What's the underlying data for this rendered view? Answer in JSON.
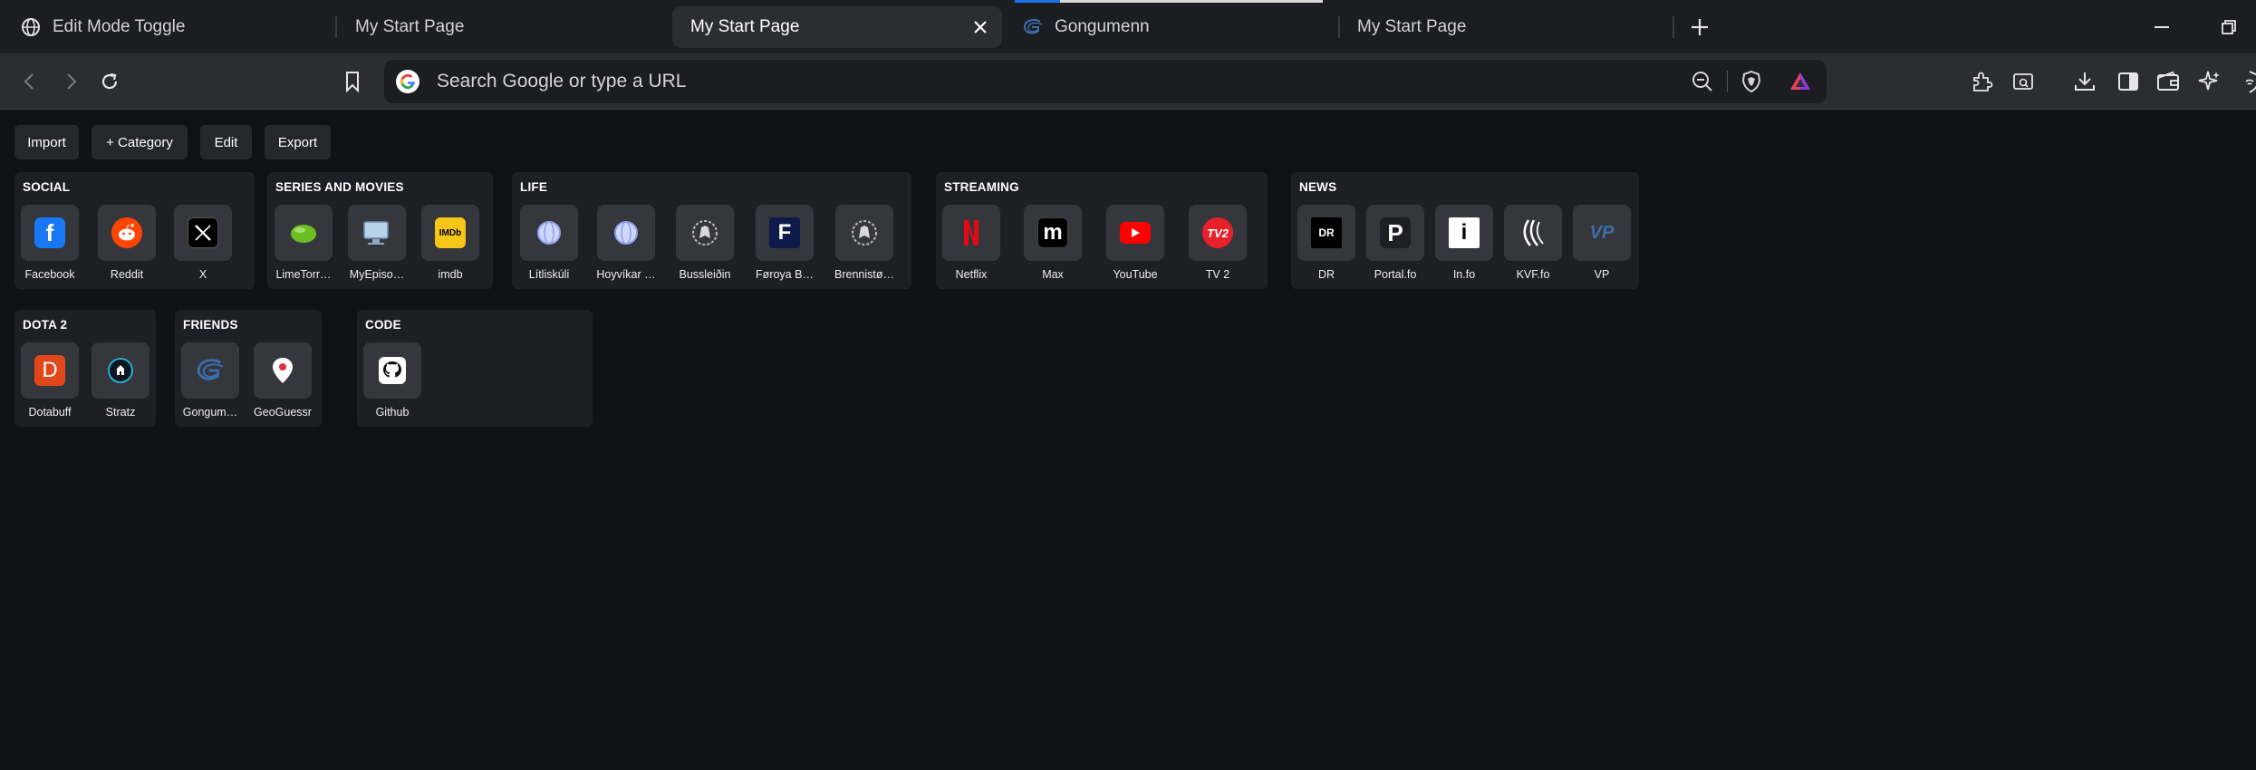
{
  "tabs": [
    {
      "title": "Edit Mode Toggle",
      "icon": "globe-icon"
    },
    {
      "title": "My Start Page",
      "icon": ""
    },
    {
      "title": "My Start Page",
      "icon": "",
      "active": true
    },
    {
      "title": "Gongumenn",
      "icon": "gongumenn-icon"
    },
    {
      "title": "My Start Page",
      "icon": ""
    }
  ],
  "address_bar": {
    "placeholder": "Search Google or type a URL"
  },
  "actions": [
    "Import",
    "+ Category",
    "Edit",
    "Export"
  ],
  "categories": [
    {
      "title": "SOCIAL",
      "items": [
        {
          "label": "Facebook",
          "icon": "facebook-icon",
          "color": "#1877f2"
        },
        {
          "label": "Reddit",
          "icon": "reddit-icon",
          "color": "#ff4500"
        },
        {
          "label": "X",
          "icon": "x-icon",
          "color": "#000000"
        }
      ]
    },
    {
      "title": "SERIES AND MOVIES",
      "items": [
        {
          "label": "LimeTorr…",
          "icon": "limetorrents-icon",
          "color": "#6bbf23"
        },
        {
          "label": "MyEpiso…",
          "icon": "myepisodes-icon",
          "color": "#8fb6d8"
        },
        {
          "label": "imdb",
          "icon": "imdb-icon",
          "color": "#f5c518"
        }
      ]
    },
    {
      "title": "LIFE",
      "items": [
        {
          "label": "Lítliskúli",
          "icon": "globe-icon",
          "color": "#8fa0e8"
        },
        {
          "label": "Hoyvíkar …",
          "icon": "globe-icon",
          "color": "#8fa0e8"
        },
        {
          "label": "Bussleiðin",
          "icon": "lion-crest-icon",
          "color": "#cfcfcf"
        },
        {
          "label": "Føroya B…",
          "icon": "foroya-banki-icon",
          "color": "#0d1a4a"
        },
        {
          "label": "Brennistø…",
          "icon": "lion-crest-icon",
          "color": "#cfcfcf"
        }
      ]
    },
    {
      "title": "STREAMING",
      "items": [
        {
          "label": "Netflix",
          "icon": "netflix-icon",
          "color": "#e50914"
        },
        {
          "label": "Max",
          "icon": "max-icon",
          "color": "#000000"
        },
        {
          "label": "YouTube",
          "icon": "youtube-icon",
          "color": "#ff0000"
        },
        {
          "label": "TV 2",
          "icon": "tv2-icon",
          "color": "#e8202a"
        }
      ]
    },
    {
      "title": "NEWS",
      "items": [
        {
          "label": "DR",
          "icon": "dr-icon",
          "color": "#000000"
        },
        {
          "label": "Portal.fo",
          "icon": "portal-icon",
          "color": "#1e1f24"
        },
        {
          "label": "In.fo",
          "icon": "info-icon",
          "color": "#ffffff"
        },
        {
          "label": "KVF.fo",
          "icon": "kvf-icon",
          "color": "#ffffff"
        },
        {
          "label": "VP",
          "icon": "vp-icon",
          "color": "#3d6fa8"
        }
      ]
    },
    {
      "title": "DOTA 2",
      "items": [
        {
          "label": "Dotabuff",
          "icon": "dotabuff-icon",
          "color": "#e2471c"
        },
        {
          "label": "Stratz",
          "icon": "stratz-icon",
          "color": "#2ab7e6"
        }
      ]
    },
    {
      "title": "FRIENDS",
      "items": [
        {
          "label": "Gongum…",
          "icon": "gongumenn-icon",
          "color": "#3a6fb0"
        },
        {
          "label": "GeoGuessr",
          "icon": "geoguessr-icon",
          "color": "#e0313b"
        }
      ]
    },
    {
      "title": "CODE",
      "items": [
        {
          "label": "Github",
          "icon": "github-icon",
          "color": "#ffffff"
        }
      ]
    }
  ]
}
